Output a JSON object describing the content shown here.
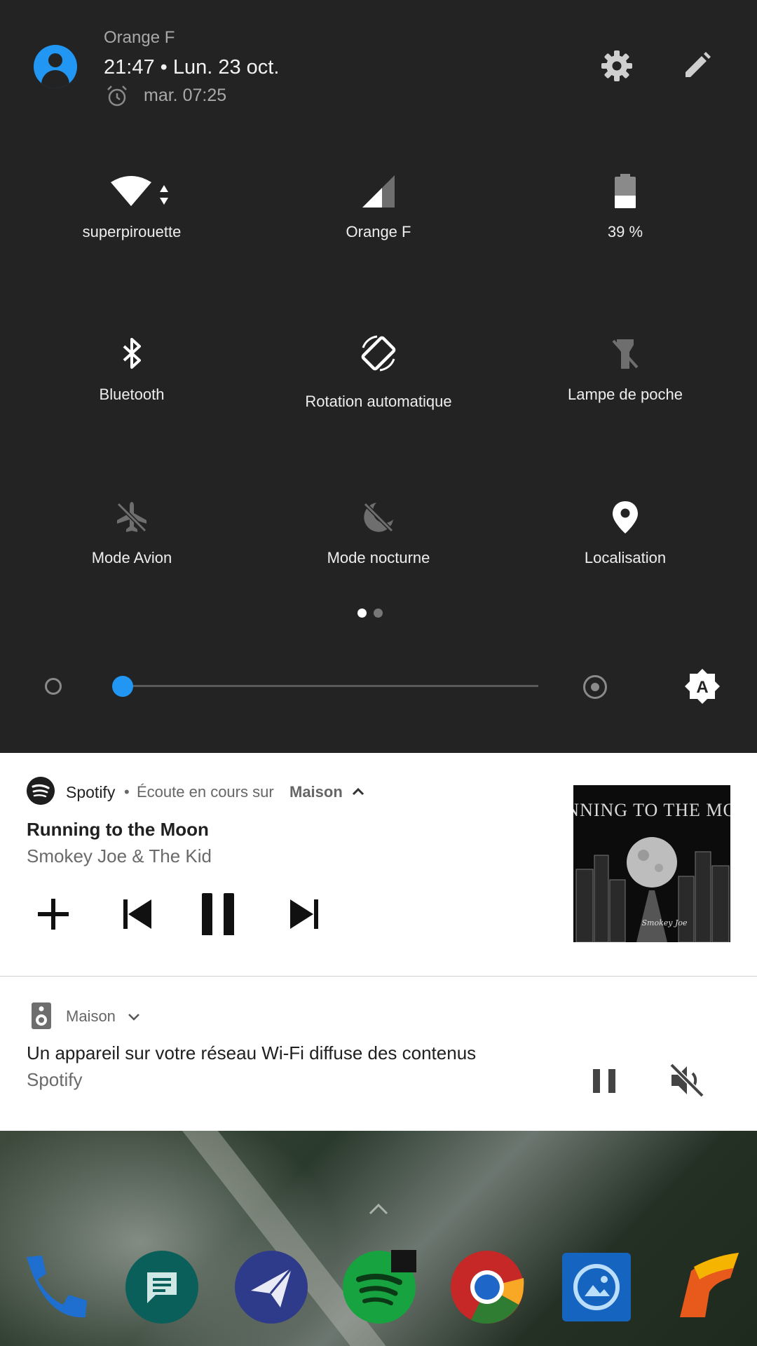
{
  "quick_settings": {
    "carrier": "Orange F",
    "datetime": "21:47 • Lun. 23 oct.",
    "alarm": "mar. 07:25",
    "tiles": [
      {
        "label": "superpirouette",
        "icon": "wifi-icon",
        "active": true
      },
      {
        "label": "Orange F",
        "icon": "cellular-signal-icon",
        "active": true
      },
      {
        "label": "39 %",
        "icon": "battery-icon",
        "active": true
      },
      {
        "label": "Bluetooth",
        "icon": "bluetooth-icon",
        "active": true
      },
      {
        "label": "Rotation automatique",
        "icon": "auto-rotate-icon",
        "active": true
      },
      {
        "label": "Lampe de poche",
        "icon": "flashlight-off-icon",
        "active": false
      },
      {
        "label": "Mode Avion",
        "icon": "airplane-off-icon",
        "active": false
      },
      {
        "label": "Mode nocturne",
        "icon": "night-mode-off-icon",
        "active": false
      },
      {
        "label": "Localisation",
        "icon": "location-icon",
        "active": true
      }
    ],
    "page_dots": {
      "count": 2,
      "active": 0
    },
    "brightness": {
      "level": 0.03,
      "auto_icon": "auto-brightness-icon"
    },
    "accent": "#2196f3"
  },
  "media_notification": {
    "app": "Spotify",
    "separator": "•",
    "listening_on": "Écoute en cours sur",
    "device": "Maison",
    "title": "Running to the Moon",
    "artist": "Smokey Joe & The Kid",
    "controls": [
      "add-icon",
      "skip-previous-icon",
      "pause-icon",
      "skip-next-icon"
    ],
    "album_art_text": "RUNNING TO THE MOON"
  },
  "cast_notification": {
    "app": "Maison",
    "title": "Un appareil sur votre réseau Wi-Fi diffuse des contenus",
    "subtitle": "Spotify",
    "actions": [
      "pause-icon",
      "mute-icon"
    ]
  },
  "home_screen": {
    "dock": [
      "phone-app-icon",
      "messages-app-icon",
      "telegram-app-icon",
      "spotify-app-icon",
      "chrome-app-icon",
      "gallery-app-icon",
      "feedly-app-icon"
    ]
  }
}
